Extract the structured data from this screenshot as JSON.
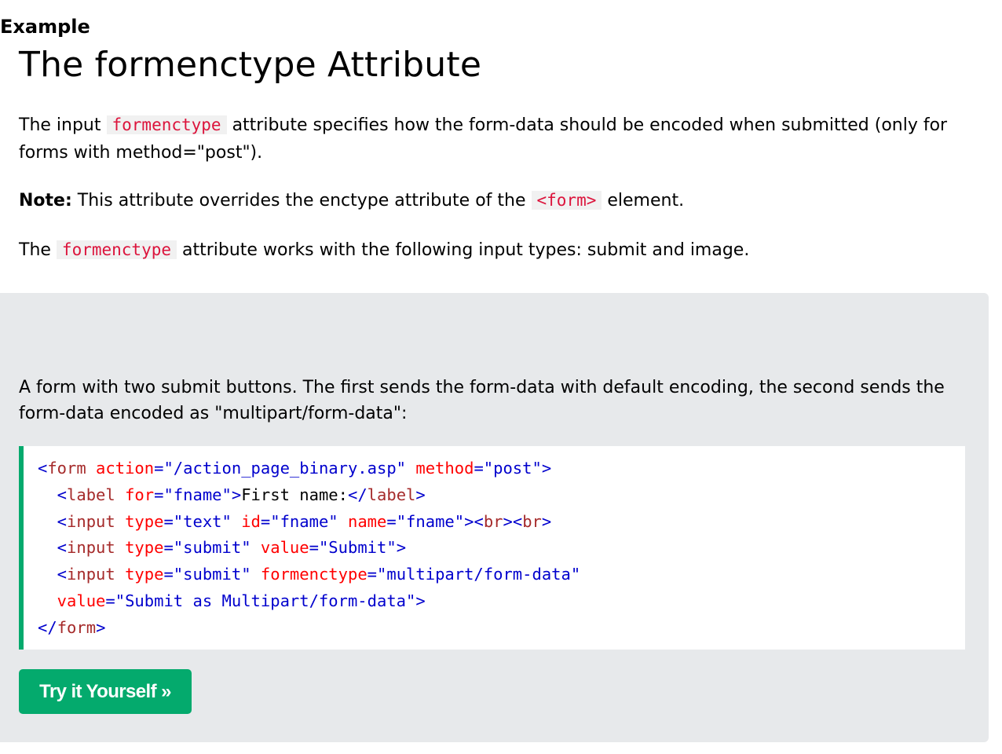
{
  "title": "The formenctype Attribute",
  "intro": {
    "before": "The input ",
    "code": "formenctype",
    "after": " attribute specifies how the form-data should be encoded when submitted (only for forms with method=\"post\")."
  },
  "note": {
    "label": "Note:",
    "before": " This attribute overrides the enctype attribute of the ",
    "code": "<form>",
    "after": " element."
  },
  "works_with": {
    "before": "The ",
    "code": "formenctype",
    "after": " attribute works with the following input types: submit and image."
  },
  "example": {
    "heading": "Example",
    "description": "A form with two submit buttons. The first sends the form-data with default encoding, the second sends the form-data encoded as \"multipart/form-data\":",
    "code_lines": [
      [
        {
          "t": "<",
          "c": "tag"
        },
        {
          "t": "form",
          "c": "tn"
        },
        {
          "t": " action",
          "c": "at"
        },
        {
          "t": "=\"/action_page_binary.asp\"",
          "c": "av"
        },
        {
          "t": " method",
          "c": "at"
        },
        {
          "t": "=\"post\"",
          "c": "av"
        },
        {
          "t": ">",
          "c": "tag"
        }
      ],
      [
        {
          "t": "  <",
          "c": "tag"
        },
        {
          "t": "label",
          "c": "tn"
        },
        {
          "t": " for",
          "c": "at"
        },
        {
          "t": "=\"fname\"",
          "c": "av"
        },
        {
          "t": ">",
          "c": "tag"
        },
        {
          "t": "First name:",
          "c": "tx"
        },
        {
          "t": "</",
          "c": "tag"
        },
        {
          "t": "label",
          "c": "tn"
        },
        {
          "t": ">",
          "c": "tag"
        }
      ],
      [
        {
          "t": "  <",
          "c": "tag"
        },
        {
          "t": "input",
          "c": "tn"
        },
        {
          "t": " type",
          "c": "at"
        },
        {
          "t": "=\"text\"",
          "c": "av"
        },
        {
          "t": " id",
          "c": "at"
        },
        {
          "t": "=\"fname\"",
          "c": "av"
        },
        {
          "t": " name",
          "c": "at"
        },
        {
          "t": "=\"fname\"",
          "c": "av"
        },
        {
          "t": "><",
          "c": "tag"
        },
        {
          "t": "br",
          "c": "tn"
        },
        {
          "t": "><",
          "c": "tag"
        },
        {
          "t": "br",
          "c": "tn"
        },
        {
          "t": ">",
          "c": "tag"
        }
      ],
      [
        {
          "t": "  <",
          "c": "tag"
        },
        {
          "t": "input",
          "c": "tn"
        },
        {
          "t": " type",
          "c": "at"
        },
        {
          "t": "=\"submit\"",
          "c": "av"
        },
        {
          "t": " value",
          "c": "at"
        },
        {
          "t": "=\"Submit\"",
          "c": "av"
        },
        {
          "t": ">",
          "c": "tag"
        }
      ],
      [
        {
          "t": "  <",
          "c": "tag"
        },
        {
          "t": "input",
          "c": "tn"
        },
        {
          "t": " type",
          "c": "at"
        },
        {
          "t": "=\"submit\"",
          "c": "av"
        },
        {
          "t": " formenctype",
          "c": "at"
        },
        {
          "t": "=\"multipart/form-data\"",
          "c": "av"
        }
      ],
      [
        {
          "t": "  value",
          "c": "at"
        },
        {
          "t": "=\"Submit as Multipart/form-data\"",
          "c": "av"
        },
        {
          "t": ">",
          "c": "tag"
        }
      ],
      [
        {
          "t": "</",
          "c": "tag"
        },
        {
          "t": "form",
          "c": "tn"
        },
        {
          "t": ">",
          "c": "tag"
        }
      ]
    ],
    "button_label": "Try it Yourself »"
  },
  "colors": {
    "accent_green": "#04aa6d",
    "panel_bg": "#e7e9eb",
    "inline_code": "#dc143c",
    "code_tag": "#0000cd",
    "code_tagname": "#a52a2a",
    "code_attr": "#ff0000",
    "code_value": "#0000cd"
  }
}
